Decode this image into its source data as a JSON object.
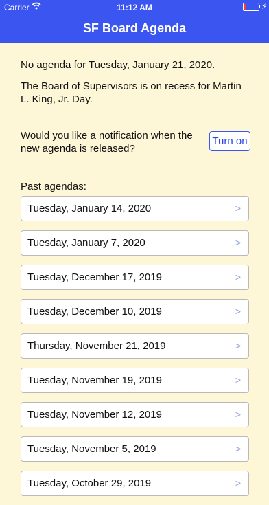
{
  "status_bar": {
    "carrier": "Carrier",
    "time": "11:12 AM"
  },
  "header": {
    "title": "SF Board Agenda",
    "color": "#3b55f0"
  },
  "main": {
    "no_agenda": "No agenda for Tuesday, January 21, 2020.",
    "recess_note": "The Board of Supervisors is on recess for Martin L. King, Jr. Day.",
    "notify_prompt": "Would you like a notification when the new agenda is released?",
    "turn_on_label": "Turn on",
    "past_label": "Past agendas:",
    "chevron": ">",
    "past_agendas": [
      "Tuesday, January 14, 2020",
      "Tuesday, January 7, 2020",
      "Tuesday, December 17, 2019",
      "Tuesday, December 10, 2019",
      "Thursday, November 21, 2019",
      "Tuesday, November 19, 2019",
      "Tuesday, November 12, 2019",
      "Tuesday, November 5, 2019",
      "Tuesday, October 29, 2019"
    ]
  }
}
